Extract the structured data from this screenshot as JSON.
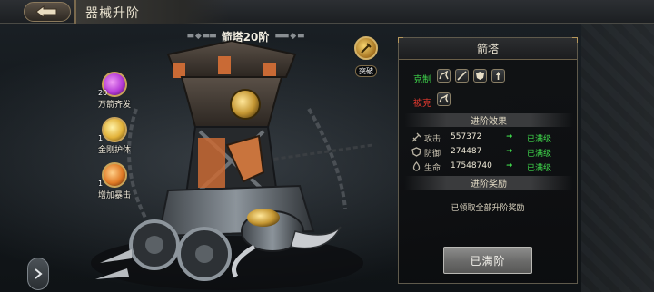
{
  "header": {
    "title": "器械升阶"
  },
  "tower": {
    "name": "箭塔20阶",
    "decor_left": "▬ ◆ ▬▬",
    "decor_right": "▬▬ ◆ ▬"
  },
  "skills": [
    {
      "name": "万箭齐发",
      "level": "20",
      "color": "#b43ad6"
    },
    {
      "name": "金刚护体",
      "level": "1",
      "color": "#e2b23a"
    },
    {
      "name": "增加暴击",
      "level": "1",
      "color": "#e07a25"
    }
  ],
  "breakthrough": {
    "label": "突破"
  },
  "panel": {
    "title": "箭塔",
    "restrain_label": "克制",
    "restrained_label": "被克",
    "restrain_icons": [
      "cavalry-icon",
      "spear-icon",
      "shield-icon",
      "arrow-icon"
    ],
    "restrained_icons": [
      "cavalry-icon"
    ],
    "effects_title": "进阶效果",
    "stats": [
      {
        "name": "攻击",
        "value": "557372",
        "status": "已满级",
        "icon": "sword-icon"
      },
      {
        "name": "防御",
        "value": "274487",
        "status": "已满级",
        "icon": "shield-icon"
      },
      {
        "name": "生命",
        "value": "17548740",
        "status": "已满级",
        "icon": "life-icon"
      }
    ],
    "arrow": "➜",
    "rewards_title": "进阶奖励",
    "rewards_text": "已领取全部升阶奖励",
    "button_label": "已满阶"
  },
  "colors": {
    "restrain": "#3ed44a",
    "restrained": "#e0382e",
    "maxed": "#3ed44a"
  }
}
